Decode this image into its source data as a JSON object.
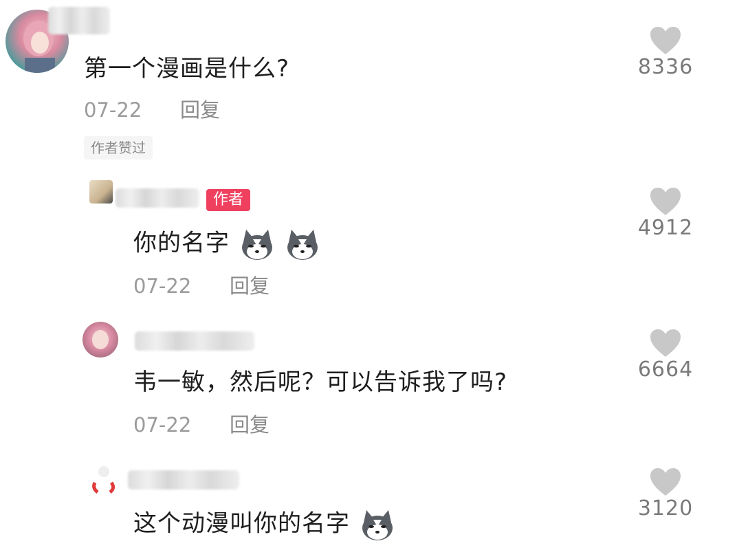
{
  "comments": [
    {
      "text": "第一个漫画是什么?",
      "date": "07-22",
      "reply": "回复",
      "liked_tag": "作者赞过",
      "likes": "8336",
      "avatar_colors": [
        "#d9a2b0",
        "#2d8a8a"
      ]
    },
    {
      "badge": "作者",
      "text": "你的名字",
      "date": "07-22",
      "reply": "回复",
      "likes": "4912",
      "emoji_icon": "husky-face-icon"
    },
    {
      "text": "韦一敏，然后呢？可以告诉我了吗?",
      "date": "07-22",
      "reply": "回复",
      "likes": "6664"
    },
    {
      "text": "这个动漫叫你的名字",
      "likes": "3120",
      "emoji_icon": "husky-face-icon"
    }
  ],
  "colors": {
    "badge": "#f0405f",
    "heart": "#c8c8c8",
    "meta_text": "#9b9b9b"
  }
}
